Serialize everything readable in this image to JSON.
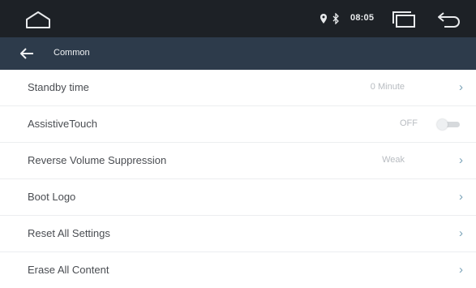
{
  "status_bar": {
    "clock": "08:05",
    "icons": [
      "home-icon",
      "location-icon",
      "bluetooth-icon",
      "recent-apps-icon",
      "return-icon"
    ]
  },
  "title_bar": {
    "title": "Common",
    "back_icon": "arrow-left-icon"
  },
  "settings": [
    {
      "label": "Standby time",
      "value": "0 Minute",
      "control": "chevron"
    },
    {
      "label": "AssistiveTouch",
      "value": "OFF",
      "control": "toggle",
      "toggle_on": false
    },
    {
      "label": "Reverse Volume Suppression",
      "value": "Weak",
      "control": "chevron"
    },
    {
      "label": "Boot Logo",
      "value": "",
      "control": "chevron"
    },
    {
      "label": "Reset All Settings",
      "value": "",
      "control": "chevron"
    },
    {
      "label": "Erase All Content",
      "value": "",
      "control": "chevron"
    }
  ],
  "chevron_glyph": "›",
  "colors": {
    "status_bar_bg": "#1d2126",
    "title_bar_bg": "#2d3b4b",
    "label_text": "#4a4d52",
    "value_text": "#b8bcc1",
    "chevron": "#7aa3b8"
  }
}
